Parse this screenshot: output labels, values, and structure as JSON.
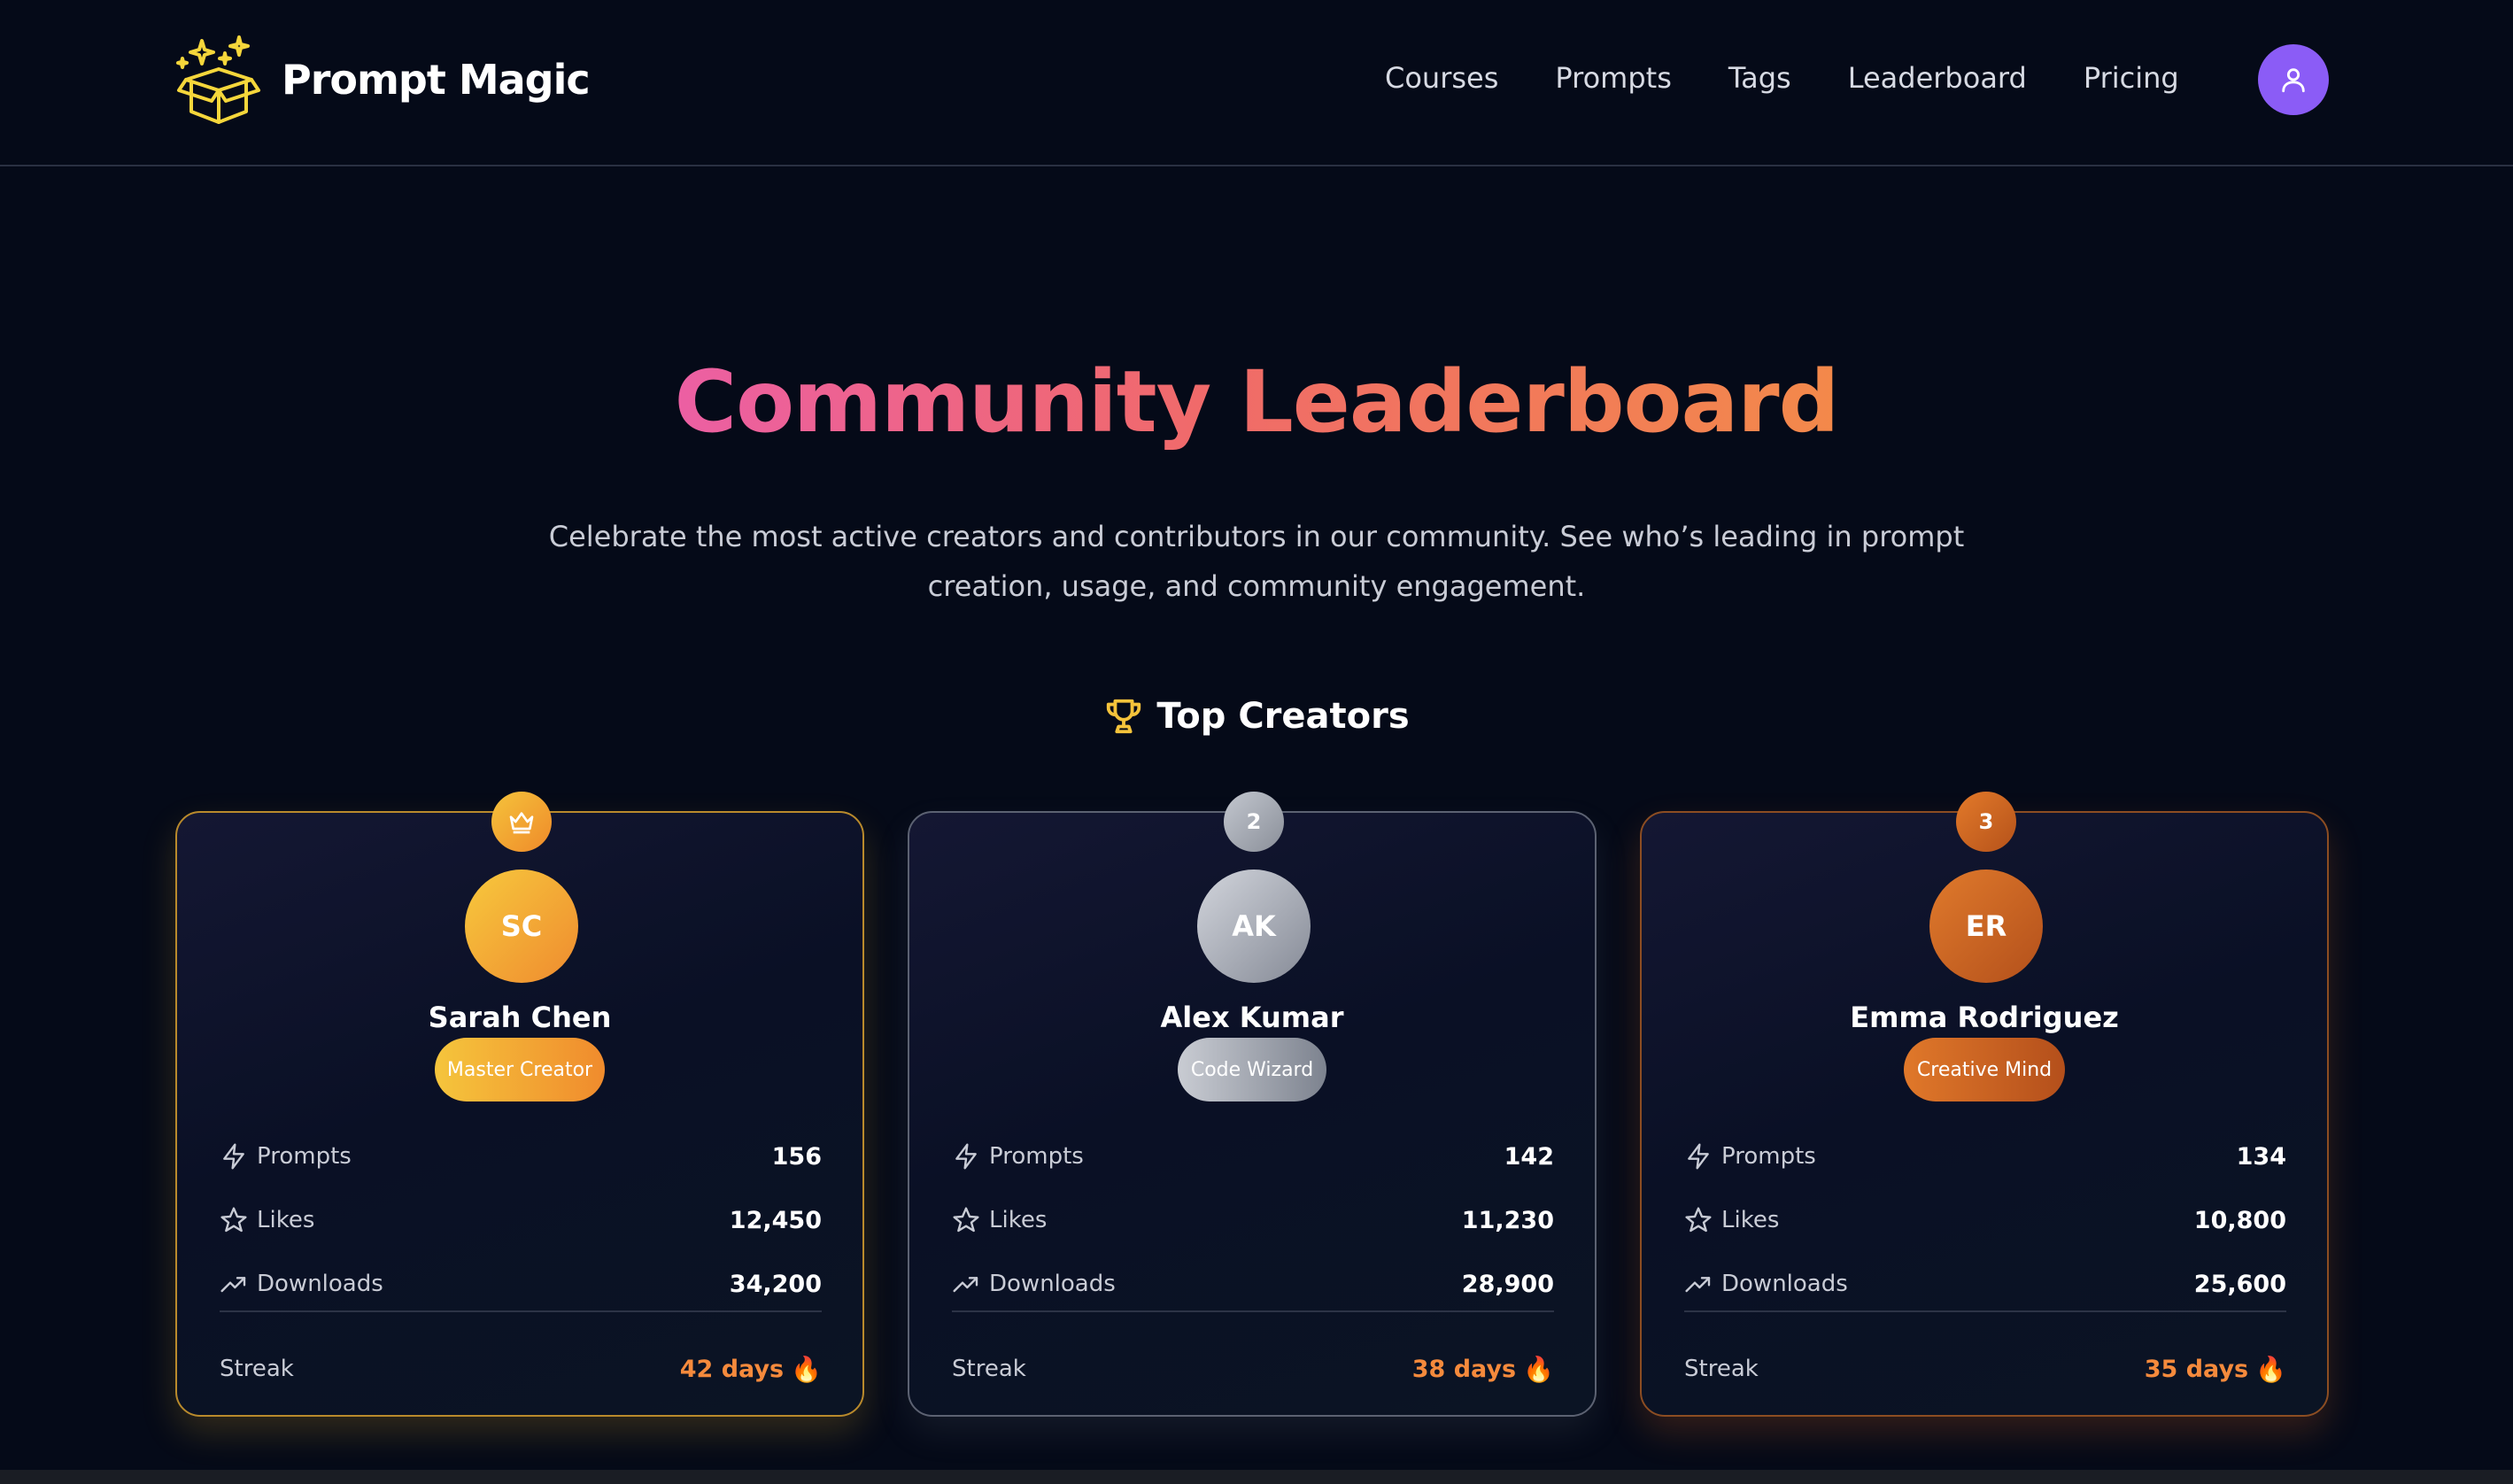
{
  "brand": {
    "name": "Prompt Magic",
    "icon": "magic-box-icon"
  },
  "nav": {
    "items": [
      "Courses",
      "Prompts",
      "Tags",
      "Leaderboard",
      "Pricing"
    ],
    "profile_icon": "user-icon"
  },
  "hero": {
    "title": "Community Leaderboard",
    "subtitle_line1": "Celebrate the most active creators and contributors in our community. See who’s leading in prompt",
    "subtitle_line2": "creation, usage, and community engagement."
  },
  "section": {
    "title": "Top Creators",
    "icon": "trophy-icon"
  },
  "labels": {
    "prompts": "Prompts",
    "likes": "Likes",
    "downloads": "Downloads",
    "streak": "Streak"
  },
  "creators": [
    {
      "rank": "1",
      "rank_icon": "crown-icon",
      "initials": "SC",
      "name": "Sarah Chen",
      "badge": "Master Creator",
      "prompts": "156",
      "likes": "12,450",
      "downloads": "34,200",
      "streak": "42 days"
    },
    {
      "rank": "2",
      "initials": "AK",
      "name": "Alex Kumar",
      "badge": "Code Wizard",
      "prompts": "142",
      "likes": "11,230",
      "downloads": "28,900",
      "streak": "38 days"
    },
    {
      "rank": "3",
      "initials": "ER",
      "name": "Emma Rodriguez",
      "badge": "Creative Mind",
      "prompts": "134",
      "likes": "10,800",
      "downloads": "25,600",
      "streak": "35 days"
    }
  ],
  "colors": {
    "accent_purple": "#8b5cf6",
    "gold": "#f5c33b",
    "bronze": "#e07a2c",
    "streak_orange": "#f58a3c",
    "title_pink": "#ec5fa3",
    "title_orange": "#f3894a"
  }
}
